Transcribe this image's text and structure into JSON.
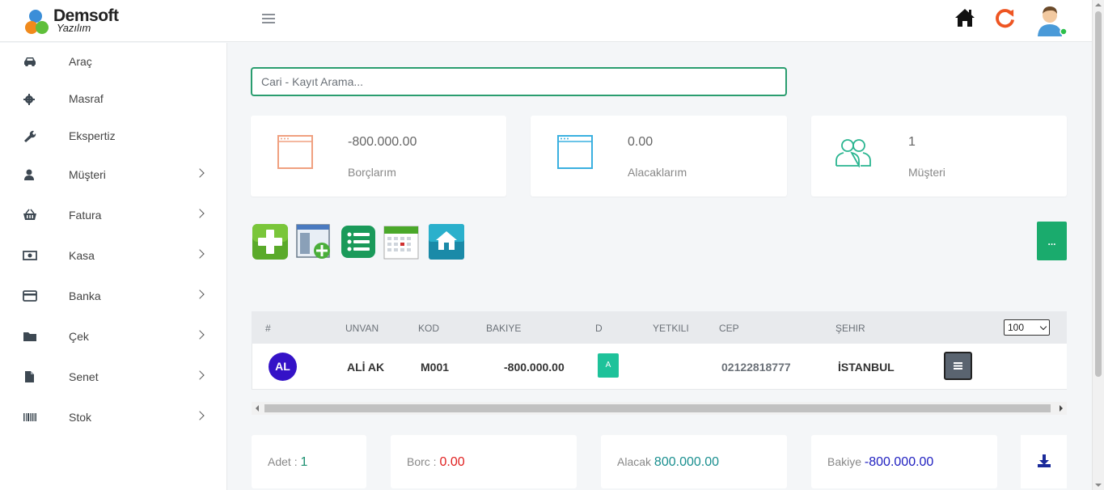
{
  "brand": {
    "name_line1": "Demsoft",
    "name_line2": "Yazılım"
  },
  "header": {
    "icons": [
      "home-icon",
      "refresh-icon",
      "user-avatar-icon"
    ]
  },
  "sidebar": {
    "items": [
      {
        "label": "Araç",
        "icon": "car-icon",
        "has_children": false
      },
      {
        "label": "Masraf",
        "icon": "gear-icon",
        "has_children": false
      },
      {
        "label": "Ekspertiz",
        "icon": "wrench-icon",
        "has_children": false
      },
      {
        "label": "Müşteri",
        "icon": "user-icon",
        "has_children": true
      },
      {
        "label": "Fatura",
        "icon": "basket-icon",
        "has_children": true
      },
      {
        "label": "Kasa",
        "icon": "money-icon",
        "has_children": true
      },
      {
        "label": "Banka",
        "icon": "credit-card-icon",
        "has_children": true
      },
      {
        "label": "Çek",
        "icon": "folder-icon",
        "has_children": true
      },
      {
        "label": "Senet",
        "icon": "file-icon",
        "has_children": true
      },
      {
        "label": "Stok",
        "icon": "barcode-icon",
        "has_children": true
      }
    ]
  },
  "search": {
    "placeholder": "Cari - Kayıt Arama..."
  },
  "cards": [
    {
      "value": "-800.000.00",
      "caption": "Borçlarım",
      "color": "#f0a080"
    },
    {
      "value": "0.00",
      "caption": "Alacaklarım",
      "color": "#3ab0e0"
    },
    {
      "value": "1",
      "caption": "Müşteri",
      "color": "#2ab590"
    }
  ],
  "toolbar": {
    "more_label": "..."
  },
  "table": {
    "columns": [
      "#",
      "UNVAN",
      "KOD",
      "BAKIYE",
      "D",
      "YETKILI",
      "CEP",
      "ŞEHIR"
    ],
    "page_size": "100",
    "rows": [
      {
        "initials": "AL",
        "unvan": "ALİ AK",
        "kod": "M001",
        "bakiye": "-800.000.00",
        "d": "A",
        "yetkili": "",
        "cep": "02122818777",
        "sehir": "İSTANBUL"
      }
    ]
  },
  "summary": {
    "adet_label": "Adet :",
    "adet_value": "1",
    "borc_label": "Borc :",
    "borc_value": "0.00",
    "alacak_label": "Alacak",
    "alacak_value": "800.000.00",
    "bakiye_label": "Bakiye",
    "bakiye_value": "-800.000.00"
  },
  "colors": {
    "accent": "#1aab6d",
    "avatar_bg": "#3412c7",
    "borc": "#e02020",
    "alacak": "#1a8f8f",
    "bakiye": "#2020c0"
  }
}
